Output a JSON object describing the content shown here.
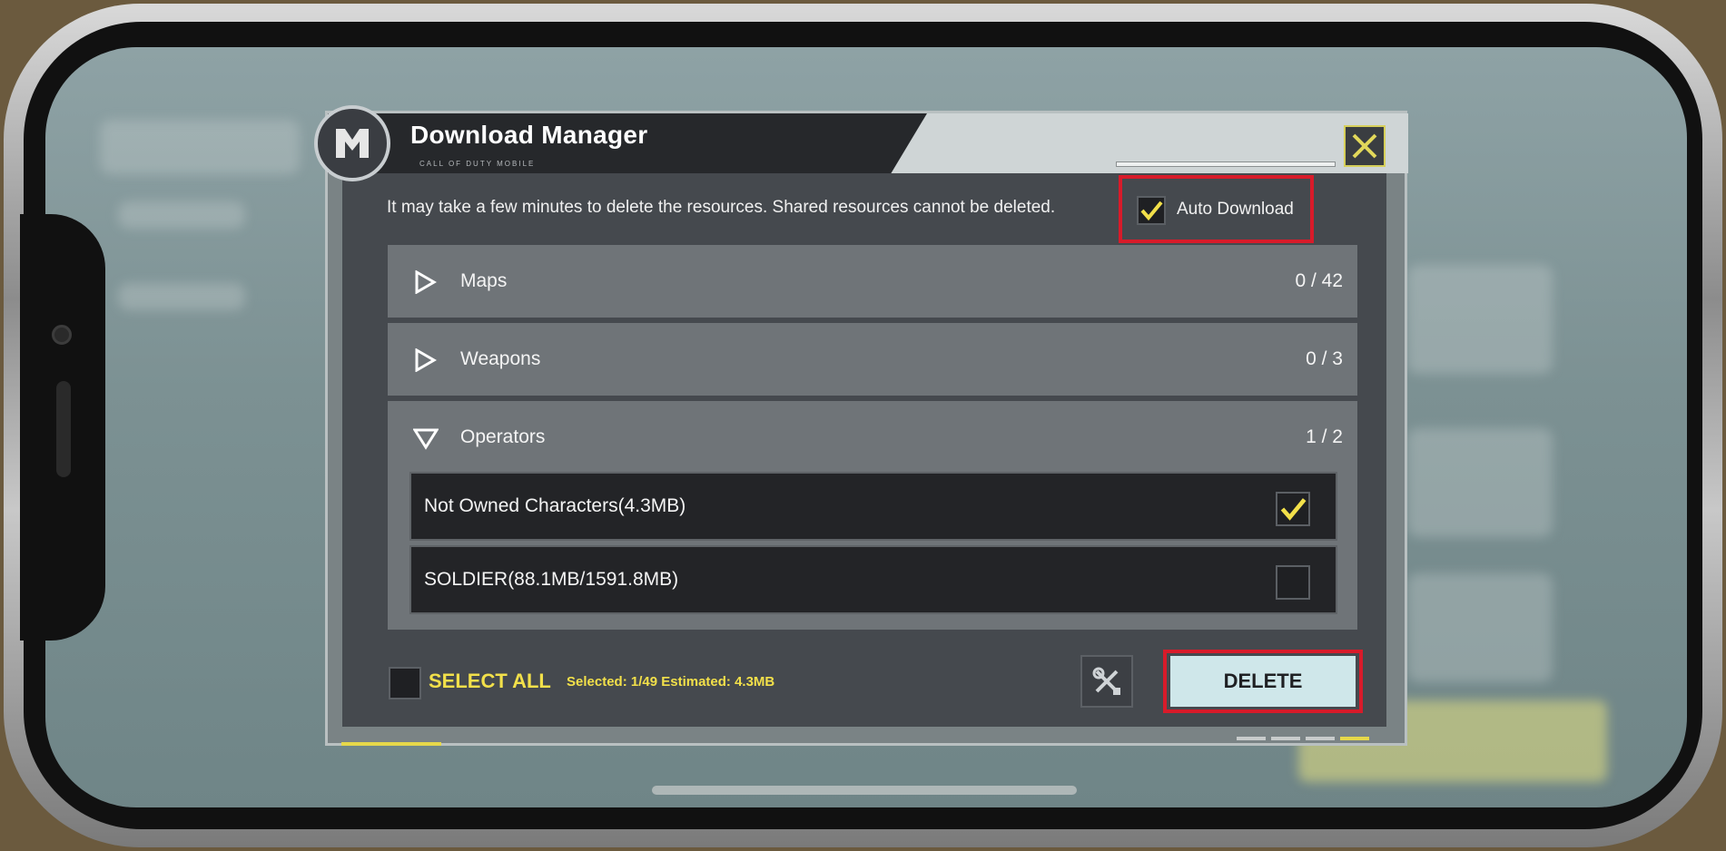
{
  "dialog": {
    "title": "Download Manager",
    "subtitle": "CALL OF DUTY MOBILE",
    "notice": "It may take a few minutes to delete the resources. Shared resources cannot be deleted.",
    "auto_download": {
      "label": "Auto Download",
      "checked": true
    }
  },
  "categories": [
    {
      "label": "Maps",
      "count": "0 / 42",
      "expanded": false
    },
    {
      "label": "Weapons",
      "count": "0 / 3",
      "expanded": false
    },
    {
      "label": "Operators",
      "count": "1 / 2",
      "expanded": true
    }
  ],
  "operator_items": [
    {
      "label": "Not Owned Characters(4.3MB)",
      "checked": true
    },
    {
      "label": "SOLDIER(88.1MB/1591.8MB)",
      "checked": false
    }
  ],
  "footer": {
    "select_all_label": "SELECT ALL",
    "selected_info": "Selected: 1/49 Estimated: 4.3MB",
    "delete_label": "DELETE"
  },
  "colors": {
    "accent_yellow": "#f2e04a",
    "highlight_red": "#d81b2a",
    "delete_bg": "#cfe7ea"
  }
}
